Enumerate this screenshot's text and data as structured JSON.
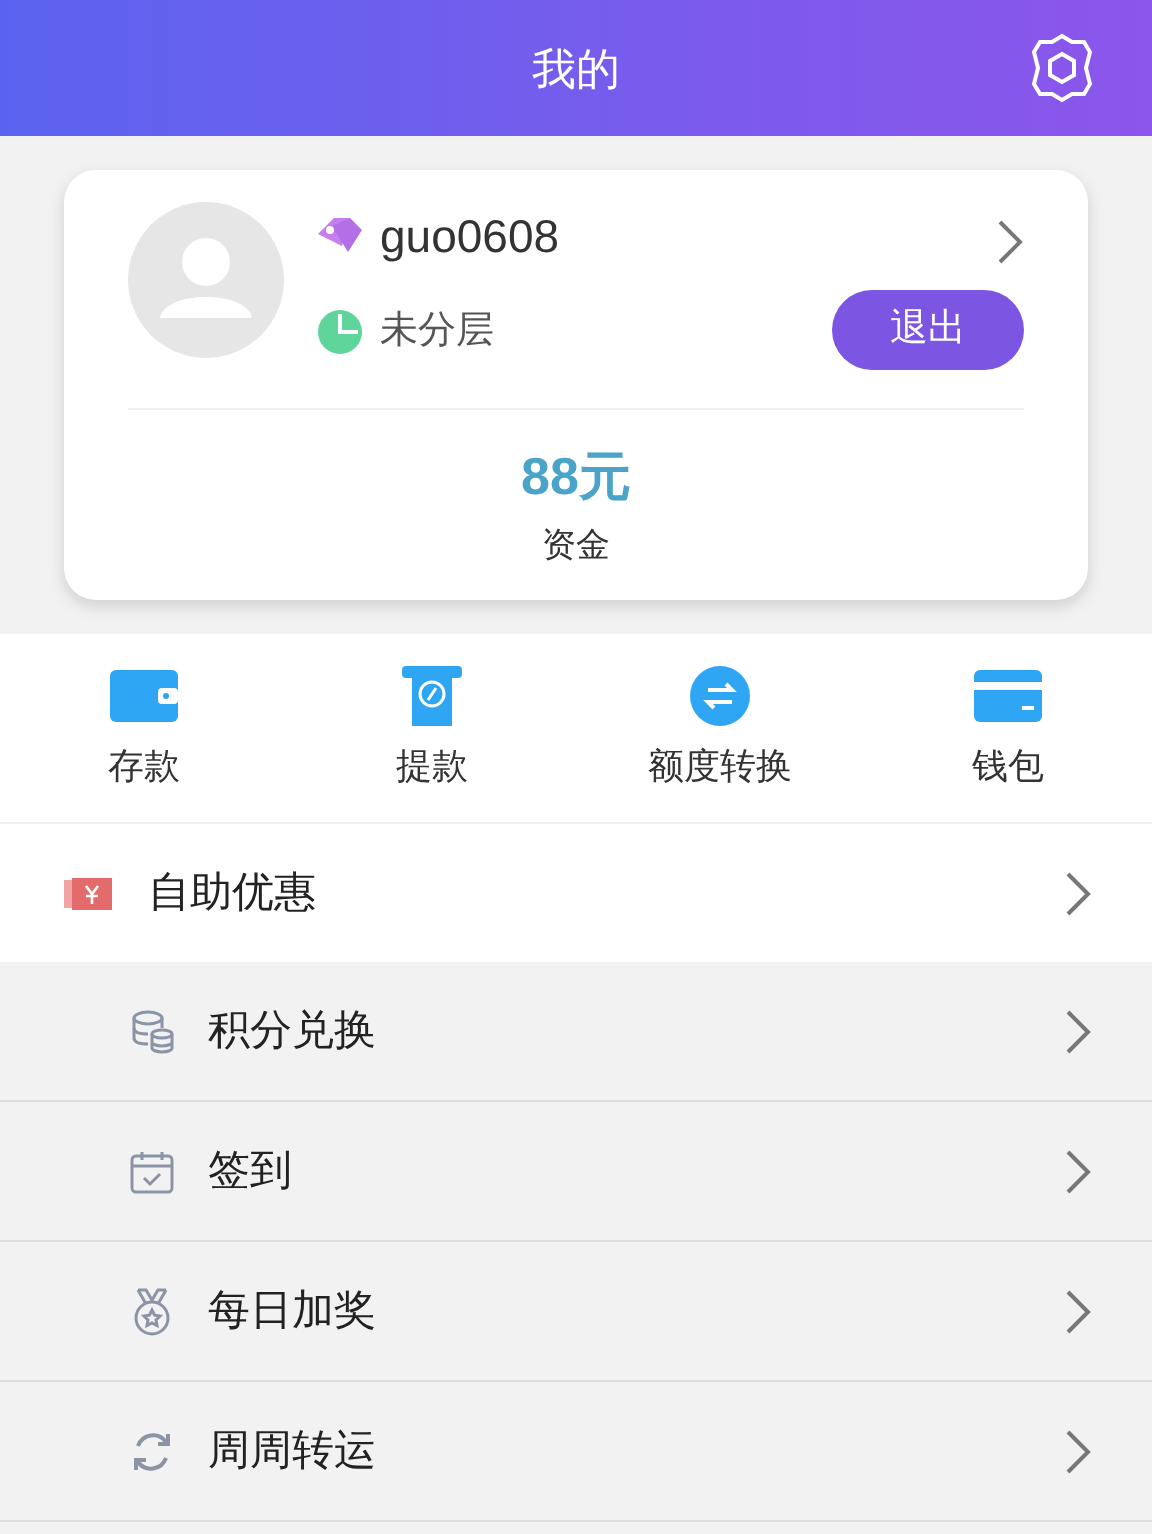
{
  "header": {
    "title": "我的"
  },
  "profile": {
    "username": "guo0608",
    "tier": "未分层",
    "logout": "退出",
    "balance": "88元",
    "balance_label": "资金"
  },
  "actions": [
    {
      "label": "存款"
    },
    {
      "label": "提款"
    },
    {
      "label": "额度转换"
    },
    {
      "label": "钱包"
    }
  ],
  "promo": {
    "label": "自助优惠"
  },
  "sub_items": [
    {
      "label": "积分兑换"
    },
    {
      "label": "签到"
    },
    {
      "label": "每日加奖"
    },
    {
      "label": "周周转运"
    }
  ]
}
